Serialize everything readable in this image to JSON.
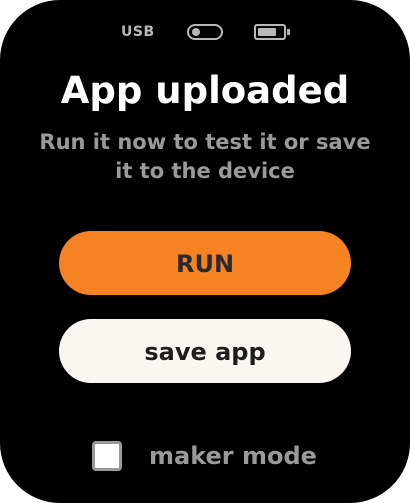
{
  "status_bar": {
    "usb_label": "USB",
    "toggle_icon": "toggle-icon",
    "battery_icon": "battery-icon"
  },
  "main": {
    "title": "App uploaded",
    "subtitle": "Run it now to test it or save it to the device"
  },
  "actions": {
    "run_label": "RUN",
    "save_label": "save app"
  },
  "maker_mode": {
    "label": "maker mode",
    "checked": false
  },
  "colors": {
    "background": "#000000",
    "accent": "#f58223",
    "secondary_button": "#faf7f2",
    "muted_text": "#9a9a9a"
  }
}
